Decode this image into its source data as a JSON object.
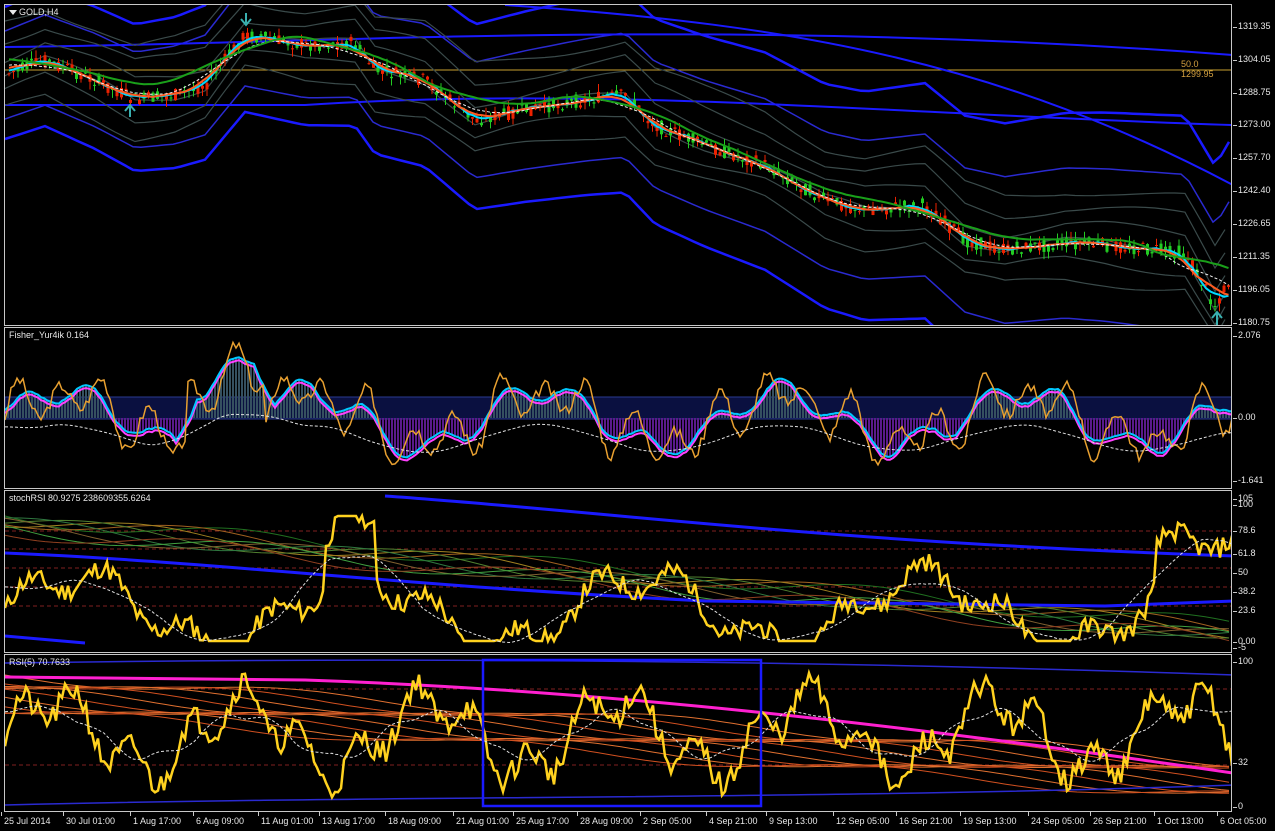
{
  "main": {
    "symbol_label": "GOLD,H4",
    "level_label": "50.0 1299.95",
    "price_ticks": [
      "1319.35",
      "1304.05",
      "1288.75",
      "1273.00",
      "1257.70",
      "1242.40",
      "1226.65",
      "1211.35",
      "1196.05",
      "1180.75"
    ]
  },
  "fisher": {
    "label": "Fisher_Yur4ik 0.164",
    "ticks": [
      "2.076",
      "0.00",
      "-1.641"
    ]
  },
  "stochrsi": {
    "label": "stochRSI 80.9275 238609355.6264",
    "ticks": [
      "105",
      "100",
      "78.6",
      "61.8",
      "50",
      "38.2",
      "23.6",
      "0.00",
      "-5"
    ]
  },
  "rsi": {
    "label": "RSI(5) 70.7633",
    "ticks": [
      "100",
      "32",
      "0"
    ]
  },
  "time_labels": [
    "25 Jul 2014",
    "30 Jul 01:00",
    "1 Aug 17:00",
    "6 Aug 09:00",
    "11 Aug 01:00",
    "13 Aug 17:00",
    "18 Aug 09:00",
    "21 Aug 01:00",
    "25 Aug 17:00",
    "28 Aug 09:00",
    "2 Sep 05:00",
    "4 Sep 21:00",
    "9 Sep 13:00",
    "12 Sep 05:00",
    "16 Sep 21:00",
    "19 Sep 13:00",
    "24 Sep 05:00",
    "26 Sep 21:00",
    "1 Oct 13:00",
    "6 Oct 05:00"
  ],
  "colors": {
    "bull_candle": "#22cc22",
    "bear_candle": "#ee2200",
    "rsi_line": "#ffd21f",
    "fisher_fast": "#00c8ff",
    "fisher_slow": "#ff40ff",
    "fisher_orange": "#e8a030",
    "histogram": "#5a1a8c",
    "band_blue": "#1a1aff",
    "highlight_box": "#1a1aff",
    "magenta_ma": "#ff20d0"
  },
  "icons": [
    "arrow-down-icon",
    "arrow-up-icon",
    "menu-triangle-icon"
  ]
}
